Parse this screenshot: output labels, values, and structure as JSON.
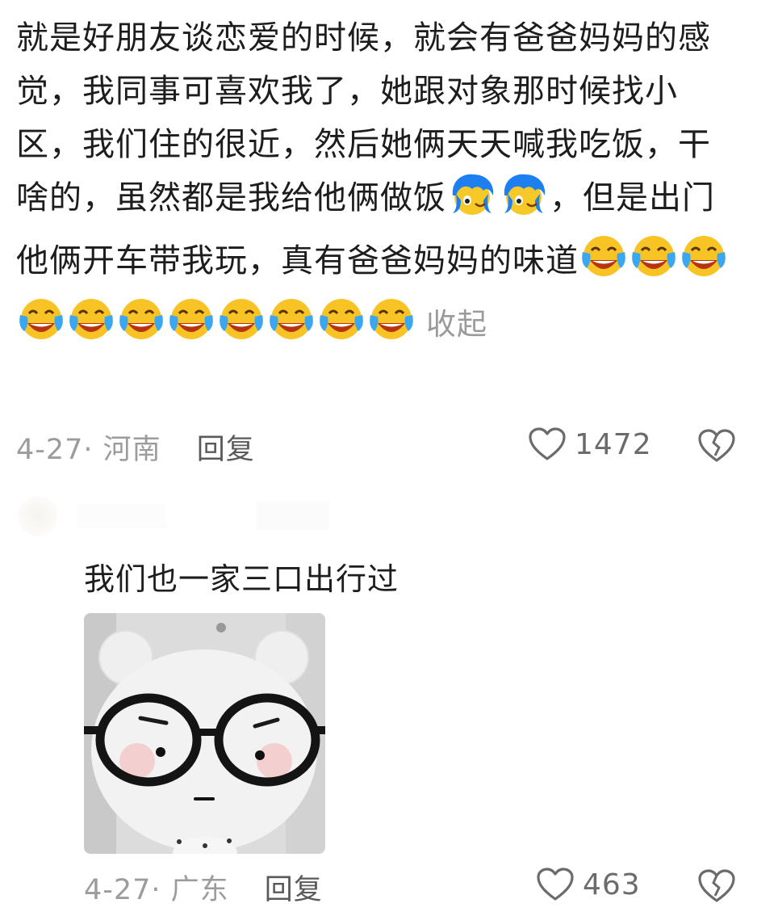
{
  "comment1": {
    "text": "就是好朋友谈恋爱的时候，就会有爸爸妈妈的感觉，我同事可喜欢我了，她跟对象那时候找小区，我们住的很近，然后她俩天天喊我吃饭，干啥的，虽然都是我给他俩做饭",
    "text_after_emoji": "，但是出门他俩开车带我玩，真有爸爸妈妈的味道",
    "collapse_label": "收起",
    "date_location": "4-27· 河南",
    "reply_label": "回复",
    "like_count": "1472",
    "cry_emoji_count": 11
  },
  "comment2": {
    "text": "我们也一家三口出行过",
    "date_location": "4-27· 广东",
    "reply_label": "回复",
    "like_count": "463"
  },
  "colors": {
    "meta_gray": "#9c9c9c",
    "reply_gray": "#5a5a5a",
    "text": "#1d1d1d"
  },
  "icons": [
    "heart-outline-icon",
    "broken-heart-icon",
    "blue-hair-emoji-icon",
    "laugh-cry-emoji-icon"
  ]
}
